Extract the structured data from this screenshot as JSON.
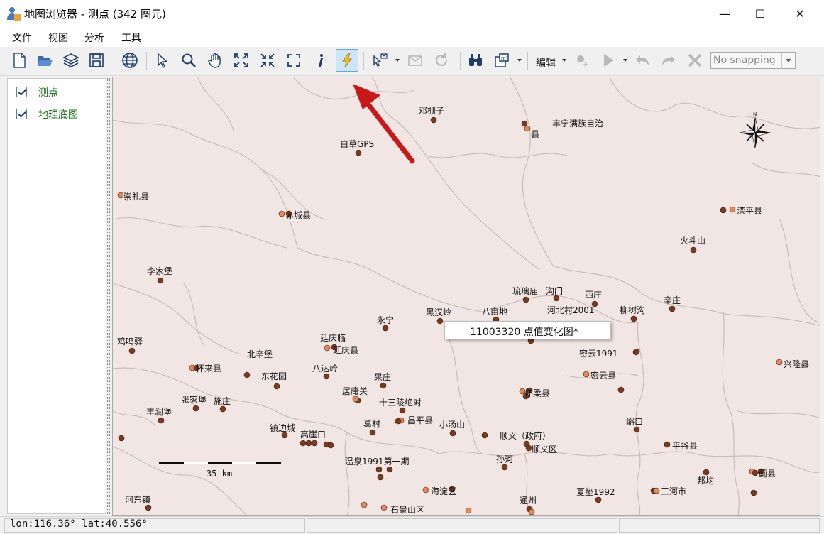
{
  "window": {
    "title": "地图浏览器 - 测点 (342 图元)",
    "minimize_glyph": "—",
    "maximize_glyph": "☐",
    "close_glyph": "✕"
  },
  "menu": {
    "items": [
      "文件",
      "视图",
      "分析",
      "工具"
    ]
  },
  "toolbar": {
    "buttons": [
      "new-file-icon",
      "open-folder-icon",
      "layers-icon",
      "save-icon",
      "globe-icon",
      "select-arrow-icon",
      "zoom-icon",
      "pan-hand-icon",
      "zoom-full-icon",
      "zoom-in-icon",
      "zoom-extent-icon",
      "identify-info-icon",
      "lightning-icon",
      "select-tool-icon",
      "mail-icon",
      "refresh-icon",
      "binoculars-icon",
      "measure-icon",
      "add-point-icon",
      "play-icon",
      "undo-icon",
      "redo-icon",
      "delete-icon"
    ],
    "active_button": "lightning-icon",
    "edit_label": "编辑",
    "snapping_value": "No snapping"
  },
  "layers": {
    "items": [
      {
        "name": "测点",
        "checked": true
      },
      {
        "name": "地理底图",
        "checked": true
      }
    ]
  },
  "map": {
    "background_color": "#f1e6e3",
    "boundary_color": "#c9b9b4",
    "point_color_dark": "#7a3a22",
    "point_color_light": "#e08a5c",
    "scalebar_label": "35 km",
    "north_label": "N",
    "labels": [
      {
        "text": "邓棚子"
      },
      {
        "text": "丰宁满族自治"
      },
      {
        "text": "县"
      },
      {
        "text": "白草GPS"
      },
      {
        "text": "崇礼县"
      },
      {
        "text": "赤城县"
      },
      {
        "text": "滦平县"
      },
      {
        "text": "火斗山"
      },
      {
        "text": "李家堡"
      },
      {
        "text": "琉璃庙"
      },
      {
        "text": "沟门"
      },
      {
        "text": "西庄"
      },
      {
        "text": "辛庄"
      },
      {
        "text": "柳树沟"
      },
      {
        "text": "河北村2001"
      },
      {
        "text": "八亩地"
      },
      {
        "text": "黑汉岭"
      },
      {
        "text": "永宁"
      },
      {
        "text": "鸡鸣驿"
      },
      {
        "text": "延庆临"
      },
      {
        "text": "延庆县"
      },
      {
        "text": "北辛堡"
      },
      {
        "text": "密云1991"
      },
      {
        "text": "兴隆县"
      },
      {
        "text": "怀来县"
      },
      {
        "text": "东花园"
      },
      {
        "text": "八达岭"
      },
      {
        "text": "果庄"
      },
      {
        "text": "密云县"
      },
      {
        "text": "居庸关"
      },
      {
        "text": "怀柔县"
      },
      {
        "text": "张家堡"
      },
      {
        "text": "施庄"
      },
      {
        "text": "十三陵绝对"
      },
      {
        "text": "丰润堡"
      },
      {
        "text": "昌平县"
      },
      {
        "text": "葛村"
      },
      {
        "text": "小汤山"
      },
      {
        "text": "顺义（政府）"
      },
      {
        "text": "峪口"
      },
      {
        "text": "镇边城"
      },
      {
        "text": "高崖口"
      },
      {
        "text": "顺义区"
      },
      {
        "text": "平谷县"
      },
      {
        "text": "孙河"
      },
      {
        "text": "温泉1991第一期"
      },
      {
        "text": "邦均"
      },
      {
        "text": "蓟县"
      },
      {
        "text": "海淀区"
      },
      {
        "text": "夏垫1992"
      },
      {
        "text": "三河市"
      },
      {
        "text": "河东镇"
      },
      {
        "text": "通州"
      },
      {
        "text": "石景山区"
      }
    ]
  },
  "popup": {
    "text": "11003320 点值变化图*"
  },
  "status": {
    "coords": "lon:116.36°  lat:40.556°"
  }
}
